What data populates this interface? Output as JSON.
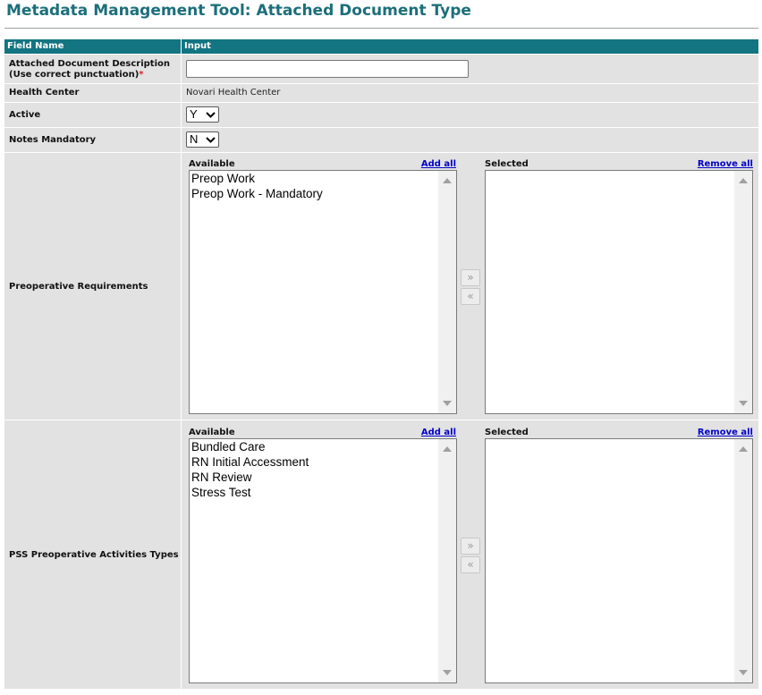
{
  "page": {
    "title": "Metadata Management Tool: Attached Document Type"
  },
  "table": {
    "col_field": "Field Name",
    "col_input": "Input"
  },
  "fields": {
    "description": {
      "label_line1": "Attached Document Description",
      "label_line2": "(Use correct punctuation)",
      "required_mark": "*",
      "value": ""
    },
    "health_center": {
      "label": "Health Center",
      "value": "Novari Health Center"
    },
    "active": {
      "label": "Active",
      "value": "Y"
    },
    "notes_mandatory": {
      "label": "Notes Mandatory",
      "value": "N"
    },
    "preop_requirements": {
      "label": "Preoperative Requirements",
      "available_caption": "Available",
      "add_all": "Add all",
      "selected_caption": "Selected",
      "remove_all": "Remove all",
      "available": [
        "Preop Work",
        "Preop Work - Mandatory"
      ],
      "selected": [],
      "move_right": "»",
      "move_left": "«"
    },
    "pss_activities": {
      "label": "PSS Preoperative Activities Types",
      "available_caption": "Available",
      "add_all": "Add all",
      "selected_caption": "Selected",
      "remove_all": "Remove all",
      "available": [
        "Bundled Care",
        "RN Initial Accessment",
        "RN Review",
        "Stress Test"
      ],
      "selected": [],
      "move_right": "»",
      "move_left": "«"
    }
  },
  "colors": {
    "title": "#1c6f7a",
    "header_bg": "#137482",
    "row_bg": "#e2e2e2",
    "link": "#0000cc",
    "required": "#e02020"
  },
  "icons": {
    "select_arrow": "chevron-down-icon",
    "scroll_up": "triangle-up-icon",
    "scroll_down": "triangle-down-icon"
  }
}
